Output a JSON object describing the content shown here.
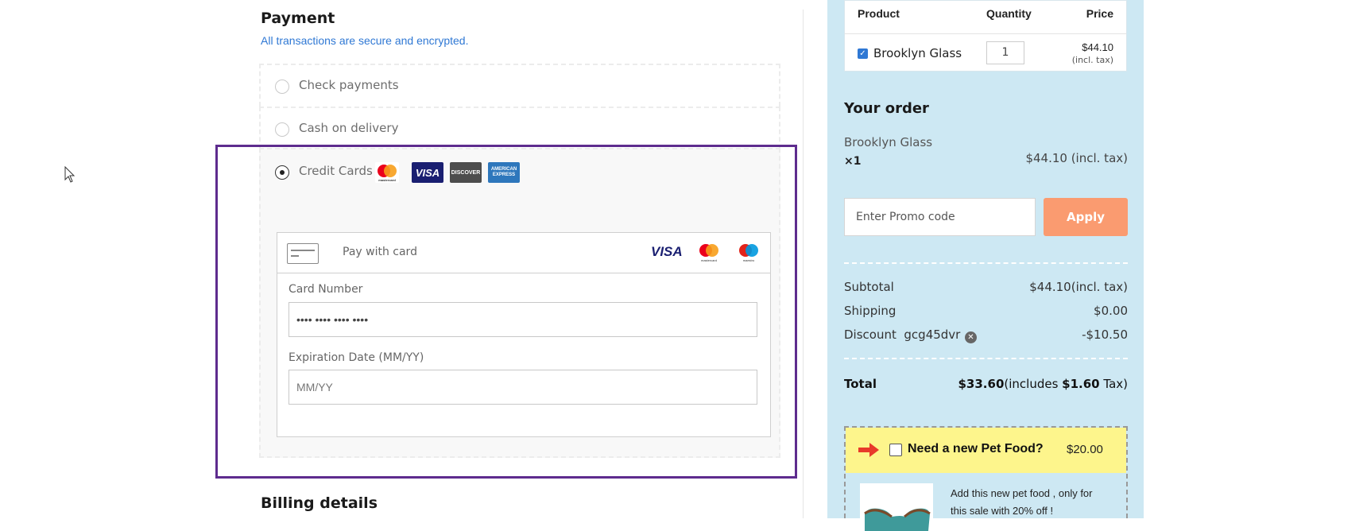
{
  "payment": {
    "title": "Payment",
    "subtitle": "All transactions are secure and encrypted.",
    "options": [
      {
        "label": "Check payments",
        "selected": false
      },
      {
        "label": "Cash on delivery",
        "selected": false
      },
      {
        "label": "Credit Cards",
        "selected": true
      }
    ],
    "card_badges": [
      "mastercard",
      "VISA",
      "DISCOVER",
      "AMERICAN EXPRESS"
    ],
    "card_form": {
      "header": "Pay with card",
      "header_brands": [
        "VISA",
        "mastercard",
        "maestro"
      ],
      "card_number_label": "Card Number",
      "card_number_value": "•••• •••• •••• ••••",
      "expiry_label": "Expiration Date  (MM/YY)",
      "expiry_placeholder": "MM/YY"
    }
  },
  "billing": {
    "title": "Billing details"
  },
  "product_table": {
    "headers": [
      "Product",
      "Quantity",
      "Price"
    ],
    "rows": [
      {
        "name": "Brooklyn Glass",
        "checked": true,
        "quantity": "1",
        "price": "$44.10",
        "tax_note": "(incl. tax)"
      }
    ]
  },
  "order": {
    "title": "Your order",
    "item_name": "Brooklyn Glass",
    "item_qty": "×1",
    "item_price": "$44.10 (incl. tax)",
    "promo_placeholder": "Enter Promo code",
    "apply_label": "Apply",
    "subtotal_label": "Subtotal",
    "subtotal_value": "$44.10(incl. tax)",
    "shipping_label": "Shipping",
    "shipping_value": "$0.00",
    "discount_label": "Discount",
    "discount_code": "gcg45dvr",
    "discount_value": "-$10.50",
    "total_label": "Total",
    "total_amount": "$33.60",
    "total_includes_prefix": "(includes ",
    "total_tax": "$1.60",
    "total_tax_suffix": " Tax)"
  },
  "upsell": {
    "title": "Need a new Pet Food?",
    "price": "$20.00",
    "description": "Add this new pet food , only for this sale with 20% off !"
  },
  "colors": {
    "accent_link": "#2f78d4",
    "highlight_border": "#5e2c8e",
    "sidebar_bg": "#cde8f3",
    "apply_button": "#fa9b70",
    "upsell_bar": "#fdf58c"
  }
}
